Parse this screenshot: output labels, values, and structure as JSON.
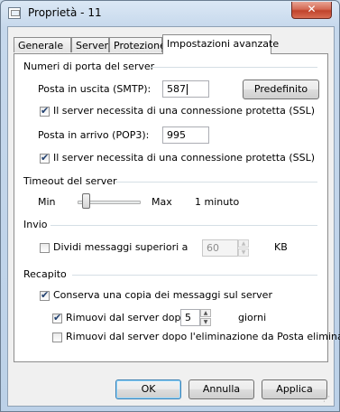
{
  "window": {
    "title": "Proprietà - 11",
    "close_label": "✕"
  },
  "tabs": [
    "Generale",
    "Server",
    "Protezione",
    "Impostazioni avanzate"
  ],
  "ports": {
    "group_label": "Numeri di porta del server",
    "smtp_label": "Posta in uscita (SMTP):",
    "smtp_value": "587",
    "default_button": "Predefinito",
    "smtp_ssl_label": "Il server necessita di una connessione protetta (SSL)",
    "smtp_ssl_checked": true,
    "pop3_label": "Posta in arrivo (POP3):",
    "pop3_value": "995",
    "pop3_ssl_label": "Il server necessita di una connessione protetta (SSL)",
    "pop3_ssl_checked": true
  },
  "timeout": {
    "group_label": "Timeout del server",
    "min_label": "Min",
    "max_label": "Max",
    "value_text": "1 minuto",
    "slider_level": 0.08
  },
  "sending": {
    "group_label": "Invio",
    "split_label": "Dividi messaggi superiori a",
    "split_checked": false,
    "split_value": "60",
    "unit": "KB"
  },
  "delivery": {
    "group_label": "Recapito",
    "keep_copy_label": "Conserva una copia dei messaggi sul server",
    "keep_copy_checked": true,
    "remove_after_label": "Rimuovi dal server dopo",
    "remove_after_checked": true,
    "remove_after_value": "5",
    "days_label": "giorni",
    "remove_deleted_label": "Rimuovi dal server dopo l'eliminazione da Posta eliminata",
    "remove_deleted_checked": false
  },
  "buttons": {
    "ok": "OK",
    "cancel": "Annulla",
    "apply": "Applica"
  },
  "colors": {
    "accent_border": "#3c7fb1",
    "close_red": "#c0432b",
    "group_line": "#d5dfe5"
  }
}
